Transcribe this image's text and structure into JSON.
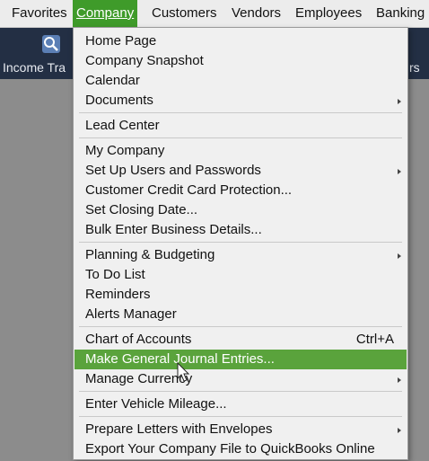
{
  "menubar": {
    "items": [
      {
        "label": "Favorites",
        "active": false
      },
      {
        "label": "Company",
        "active": true
      },
      {
        "label": "Customers",
        "active": false
      },
      {
        "label": "Vendors",
        "active": false
      },
      {
        "label": "Employees",
        "active": false
      },
      {
        "label": "Banking",
        "active": false
      }
    ]
  },
  "iconbar": {
    "left_label": "Income Tra",
    "right_label": "rs",
    "icon": "magnifier-icon"
  },
  "menu": {
    "sections": [
      [
        {
          "label": "Home Page",
          "submenu": false
        },
        {
          "label": "Company Snapshot",
          "submenu": false
        },
        {
          "label": "Calendar",
          "submenu": false
        },
        {
          "label": "Documents",
          "submenu": true
        }
      ],
      [
        {
          "label": "Lead Center",
          "submenu": false
        }
      ],
      [
        {
          "label": "My Company",
          "submenu": false
        },
        {
          "label": "Set Up Users and Passwords",
          "submenu": true
        },
        {
          "label": "Customer Credit Card Protection...",
          "submenu": false
        },
        {
          "label": "Set Closing Date...",
          "submenu": false
        },
        {
          "label": "Bulk Enter Business Details...",
          "submenu": false
        }
      ],
      [
        {
          "label": "Planning & Budgeting",
          "submenu": true
        },
        {
          "label": "To Do List",
          "submenu": false
        },
        {
          "label": "Reminders",
          "submenu": false
        },
        {
          "label": "Alerts Manager",
          "submenu": false
        }
      ],
      [
        {
          "label": "Chart of Accounts",
          "shortcut": "Ctrl+A",
          "submenu": false
        },
        {
          "label": "Make General Journal Entries...",
          "submenu": false,
          "highlighted": true
        },
        {
          "label": "Manage Currency",
          "submenu": true
        }
      ],
      [
        {
          "label": "Enter Vehicle Mileage...",
          "submenu": false
        }
      ],
      [
        {
          "label": "Prepare Letters with Envelopes",
          "submenu": true
        },
        {
          "label": "Export Your Company File to QuickBooks Online",
          "submenu": false
        }
      ]
    ]
  },
  "colors": {
    "accent": "#3f9b2a",
    "highlight": "#5aa33c",
    "iconbar": "#232f44"
  }
}
